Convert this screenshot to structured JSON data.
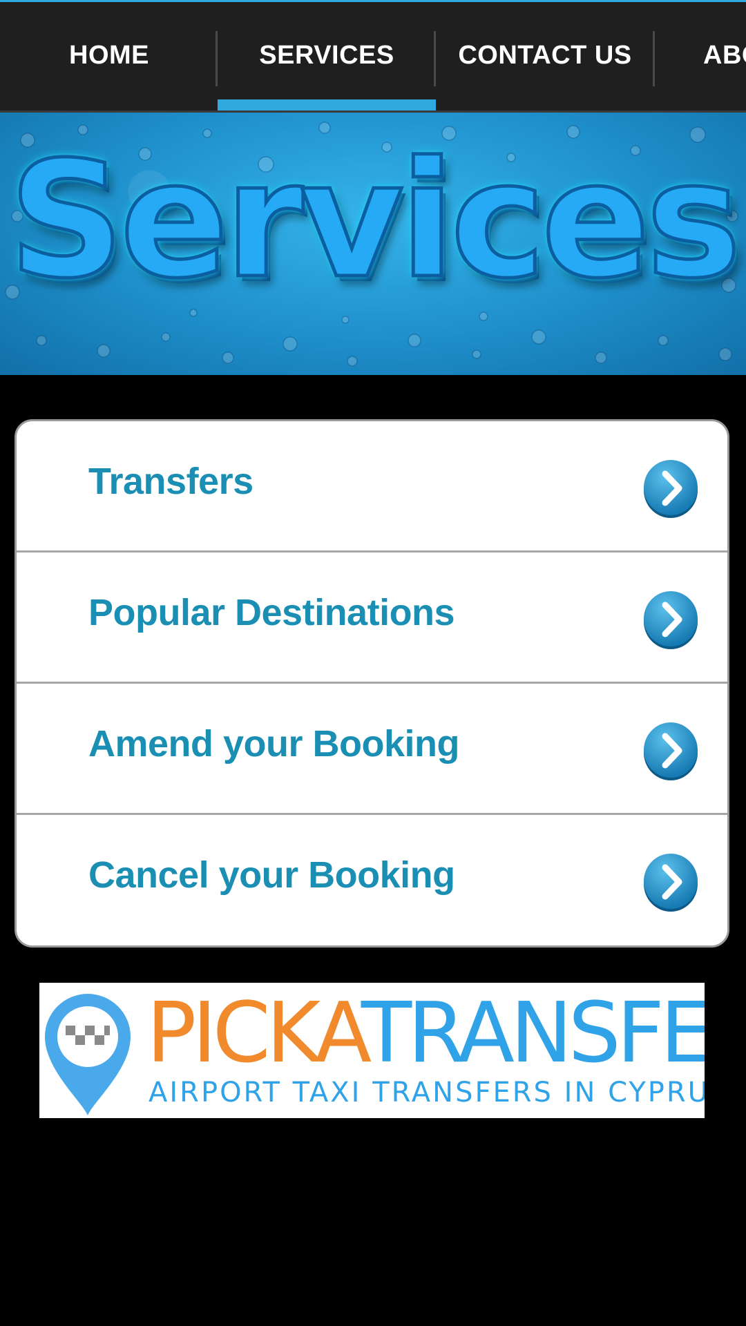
{
  "nav": {
    "tabs": [
      {
        "label": "HOME",
        "active": false
      },
      {
        "label": "SERVICES",
        "active": true
      },
      {
        "label": "CONTACT US",
        "active": false
      },
      {
        "label": "ABO",
        "active": false
      }
    ],
    "accent_color": "#2fa9e0"
  },
  "banner": {
    "title": "Services"
  },
  "menu": {
    "items": [
      {
        "label": "Transfers",
        "icon": "chevron-right-icon"
      },
      {
        "label": "Popular Destinations",
        "icon": "chevron-right-icon"
      },
      {
        "label": "Amend your Booking",
        "icon": "chevron-right-icon"
      },
      {
        "label": "Cancel your Booking",
        "icon": "chevron-right-icon"
      }
    ],
    "label_color": "#1a8fb3"
  },
  "logo": {
    "wordmark_orange": "PICKA",
    "wordmark_blue": "TRANSFER",
    "tagline": "AIRPORT TAXI TRANSFERS IN CYPRUS",
    "orange": "#f08a2c",
    "blue": "#2fa2e8"
  }
}
